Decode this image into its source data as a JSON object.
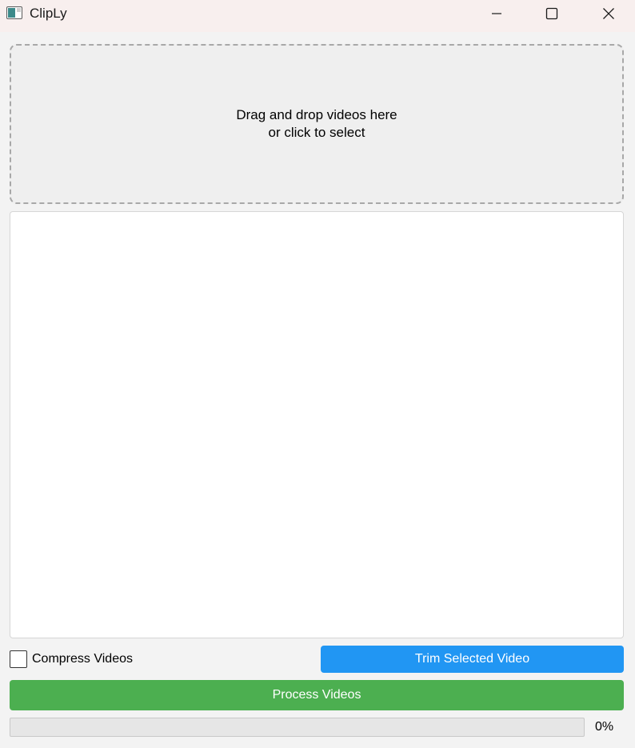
{
  "window": {
    "title": "ClipLy",
    "icon": "app-window-icon",
    "controls": {
      "minimize_icon": "minimize-icon",
      "maximize_icon": "maximize-icon",
      "close_icon": "close-icon"
    }
  },
  "dropzone": {
    "line1": "Drag and drop videos here",
    "line2": "or click to select"
  },
  "file_list": {
    "items": []
  },
  "controls": {
    "compress_label": "Compress Videos",
    "compress_checked": false,
    "trim_label": "Trim Selected Video",
    "process_label": "Process Videos"
  },
  "progress": {
    "value": 0,
    "label": "0%"
  },
  "colors": {
    "trim_button": "#2196f3",
    "process_button": "#4caf50",
    "titlebar": "#f8efee"
  }
}
